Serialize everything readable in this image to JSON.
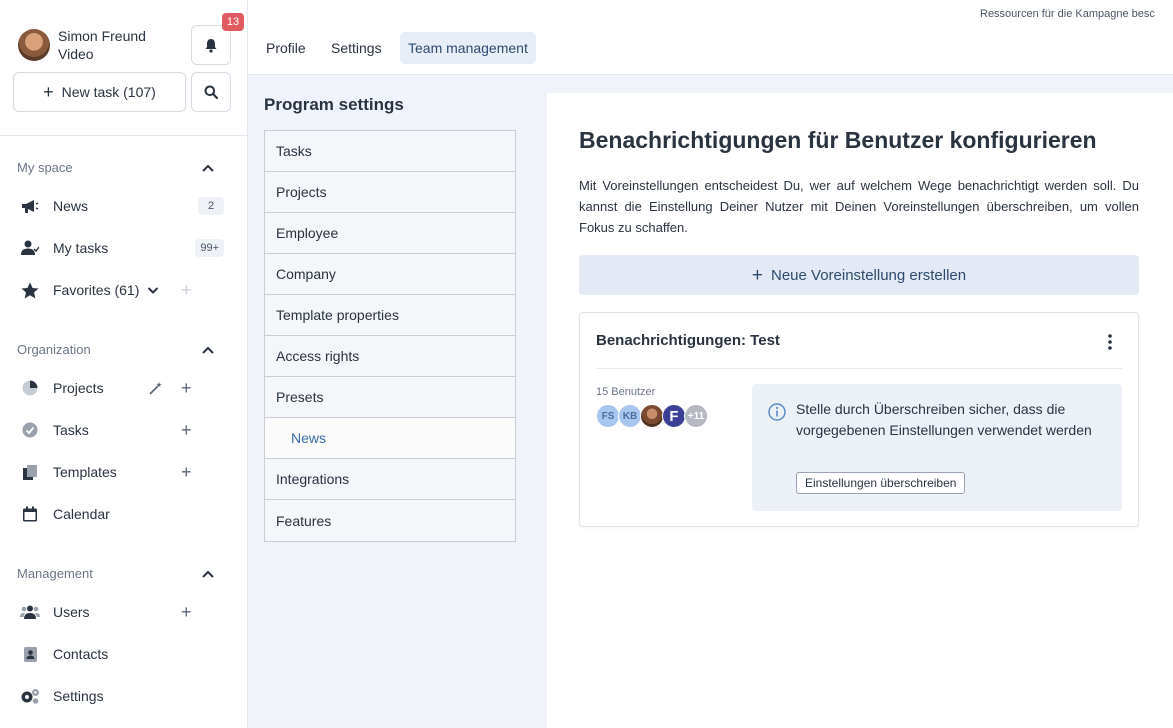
{
  "user": {
    "name": "Simon Freund",
    "role": "Video"
  },
  "notifications": {
    "count": "13"
  },
  "new_task": {
    "label": "New task (107)"
  },
  "sidebar": {
    "my_space": {
      "title": "My space",
      "items": [
        {
          "label": "News",
          "count": "2"
        },
        {
          "label": "My tasks",
          "count": "99+"
        },
        {
          "label": "Favorites (61)"
        }
      ]
    },
    "organization": {
      "title": "Organization",
      "items": [
        {
          "label": "Projects"
        },
        {
          "label": "Tasks"
        },
        {
          "label": "Templates"
        },
        {
          "label": "Calendar"
        }
      ]
    },
    "management": {
      "title": "Management",
      "items": [
        {
          "label": "Users"
        },
        {
          "label": "Contacts"
        },
        {
          "label": "Settings"
        }
      ]
    }
  },
  "topbar": {
    "breadcrumb": "Ressourcen für die Kampagne besc",
    "tabs": [
      {
        "label": "Profile"
      },
      {
        "label": "Settings"
      },
      {
        "label": "Team management"
      }
    ]
  },
  "program_settings": {
    "title": "Program settings",
    "items": [
      {
        "label": "Tasks"
      },
      {
        "label": "Projects"
      },
      {
        "label": "Employee"
      },
      {
        "label": "Company"
      },
      {
        "label": "Template properties"
      },
      {
        "label": "Access rights"
      },
      {
        "label": "Presets"
      },
      {
        "label": "News"
      },
      {
        "label": "Integrations"
      },
      {
        "label": "Features"
      }
    ]
  },
  "content": {
    "title": "Benachrichtigungen für Benutzer konfigurieren",
    "description": "Mit Voreinstellungen entscheidest Du, wer auf welchem Wege benachrichtigt werden soll. Du kannst die Einstellung Deiner Nutzer mit Deinen Voreinstellungen überschreiben, um vollen Fokus zu schaffen.",
    "new_preset_label": "Neue Voreinstellung erstellen",
    "card": {
      "title": "Benachrichtigungen: Test",
      "users_count": "15 Benutzer",
      "avatars": [
        "FS",
        "KB",
        "",
        "F",
        "+11"
      ],
      "info_text": "Stelle durch Überschreiben sicher, dass die vorgegebenen Einstellungen verwendet werden",
      "override_label": "Einstellungen überschreiben"
    }
  },
  "colors": {
    "accent": "#2c4a6e",
    "badge": "#e05a60",
    "main_bg": "#f0f4fa"
  }
}
